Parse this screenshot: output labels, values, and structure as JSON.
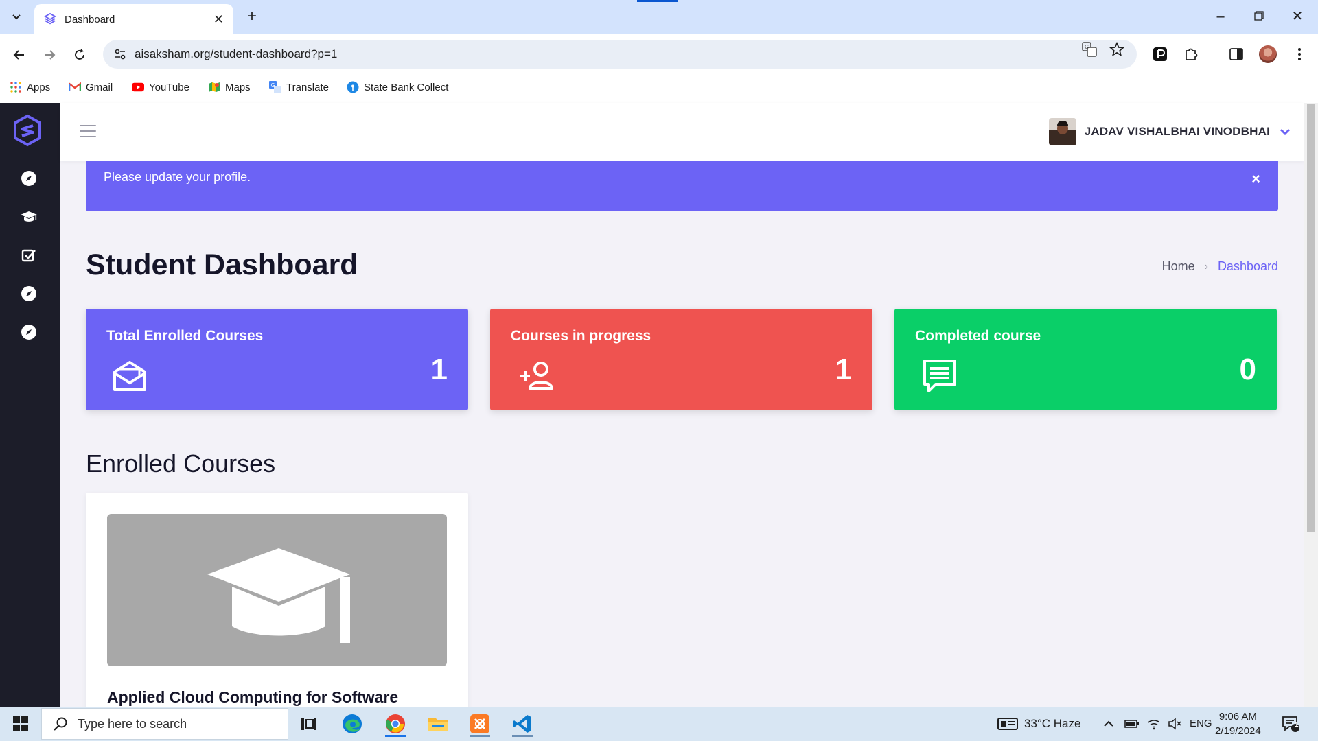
{
  "browser": {
    "tab_title": "Dashboard",
    "url": "aisaksham.org/student-dashboard?p=1",
    "bookmarks": [
      {
        "label": "Apps",
        "icon": "apps-grid-icon"
      },
      {
        "label": "Gmail",
        "icon": "gmail-icon"
      },
      {
        "label": "YouTube",
        "icon": "youtube-icon"
      },
      {
        "label": "Maps",
        "icon": "maps-icon"
      },
      {
        "label": "Translate",
        "icon": "translate-icon"
      },
      {
        "label": "State Bank Collect",
        "icon": "sbi-icon"
      }
    ]
  },
  "header": {
    "user_name": "JADAV VISHALBHAI VINODBHAI"
  },
  "sidebar": {
    "items": [
      {
        "icon": "compass-icon"
      },
      {
        "icon": "graduation-cap-icon"
      },
      {
        "icon": "checkbox-icon"
      },
      {
        "icon": "compass-icon"
      },
      {
        "icon": "compass-icon"
      }
    ]
  },
  "alert": {
    "message": "Please update your profile.",
    "close": "×"
  },
  "page": {
    "title": "Student Dashboard",
    "breadcrumb": {
      "home": "Home",
      "separator": "›",
      "current": "Dashboard"
    }
  },
  "stats": [
    {
      "label": "Total Enrolled Courses",
      "value": "1",
      "color": "#6c63f5",
      "icon": "mail-open-icon"
    },
    {
      "label": "Courses in progress",
      "value": "1",
      "color": "#ef5350",
      "icon": "user-plus-icon"
    },
    {
      "label": "Completed course",
      "value": "0",
      "color": "#0acf68",
      "icon": "message-icon"
    }
  ],
  "enrolled": {
    "section_title": "Enrolled Courses",
    "courses": [
      {
        "title": "Applied Cloud Computing for Software"
      }
    ]
  },
  "taskbar": {
    "search_placeholder": "Type here to search",
    "weather": "33°C  Haze",
    "language": "ENG",
    "time": "9:06 AM",
    "date": "2/19/2024",
    "notification_count": "1"
  },
  "colors": {
    "accent": "#6c63f5",
    "danger": "#ef5350",
    "success": "#0acf68",
    "sidebar": "#1c1d29"
  }
}
